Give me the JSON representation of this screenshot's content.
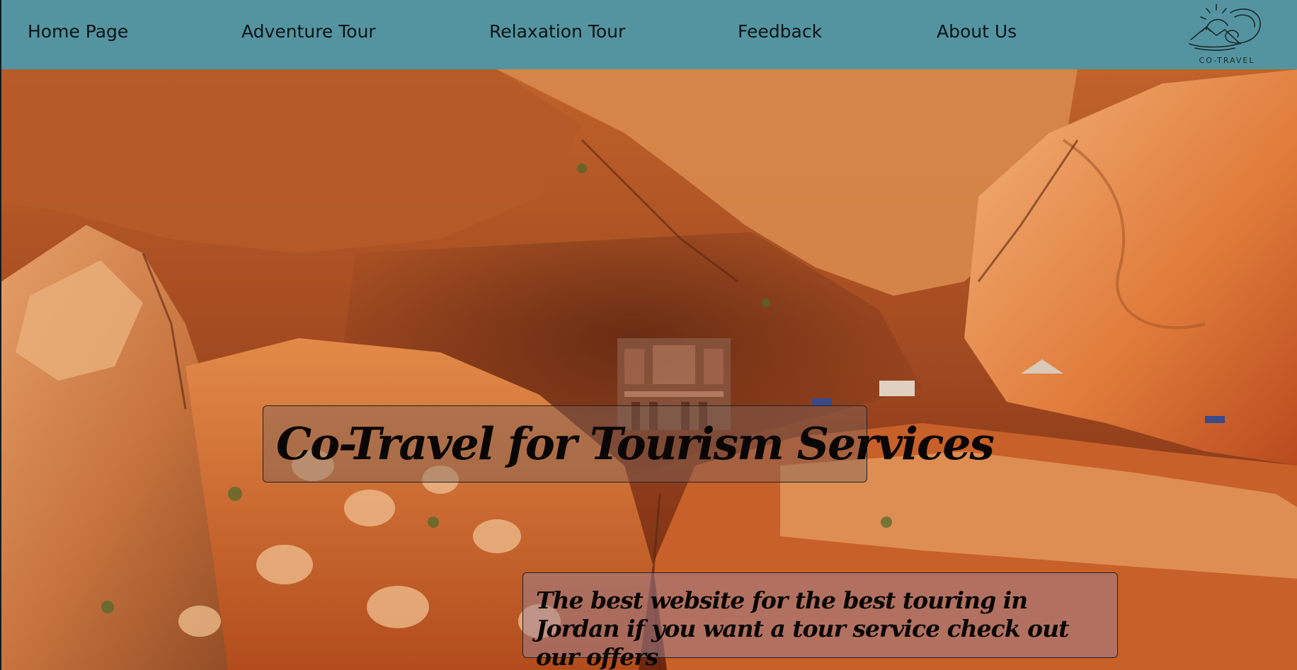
{
  "nav": {
    "items": [
      {
        "label": "Home Page"
      },
      {
        "label": "Adventure Tour"
      },
      {
        "label": "Relaxation Tour"
      },
      {
        "label": "Feedback"
      },
      {
        "label": "About Us"
      }
    ],
    "logo_text": "CO-TRAVEL",
    "logo_icon": "mountain-wave-sun-logo"
  },
  "hero": {
    "title": "Co-Travel for Tourism Services",
    "subtitle": "The best website for the best touring in Jordan if you want a tour service check out our offers",
    "background_scene": "petra-canyon-aerial"
  },
  "colors": {
    "nav_bg": "#5494a0",
    "text_dark": "#0b1416",
    "rock_orange": "#c8682c",
    "rock_light": "#e8a56a",
    "rock_dark": "#6a2a14"
  }
}
